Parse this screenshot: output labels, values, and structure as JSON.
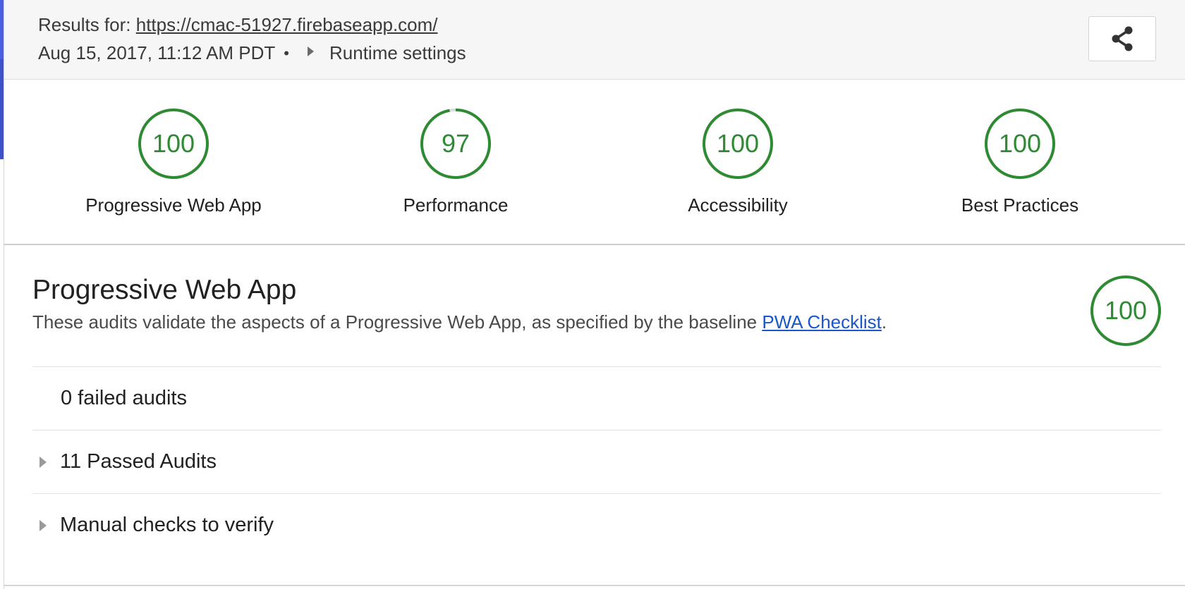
{
  "header": {
    "results_prefix": "Results for:",
    "url": "https://cmac-51927.firebaseapp.com/",
    "timestamp": "Aug 15, 2017, 11:12 AM PDT",
    "bullet": "•",
    "runtime_settings_label": "Runtime settings"
  },
  "gauges": [
    {
      "score": "100",
      "fraction": 1.0,
      "label": "Progressive Web App"
    },
    {
      "score": "97",
      "fraction": 0.97,
      "label": "Performance"
    },
    {
      "score": "100",
      "fraction": 1.0,
      "label": "Accessibility"
    },
    {
      "score": "100",
      "fraction": 1.0,
      "label": "Best Practices"
    }
  ],
  "category": {
    "title": "Progressive Web App",
    "description_prefix": "These audits validate the aspects of a Progressive Web App, as specified by the baseline",
    "checklist_link": "PWA Checklist",
    "description_suffix": ".",
    "score": "100",
    "fraction": 1.0,
    "groups": {
      "failed": "0 failed audits",
      "passed": "11 Passed Audits",
      "manual": "Manual checks to verify"
    }
  },
  "colors": {
    "pass": "#2e8b34",
    "track": "#dcdcdc",
    "link": "#1a56cc",
    "accent": "#3f51c6"
  },
  "icons": {
    "share": "share-icon",
    "disclosure": "triangle-right-icon"
  }
}
